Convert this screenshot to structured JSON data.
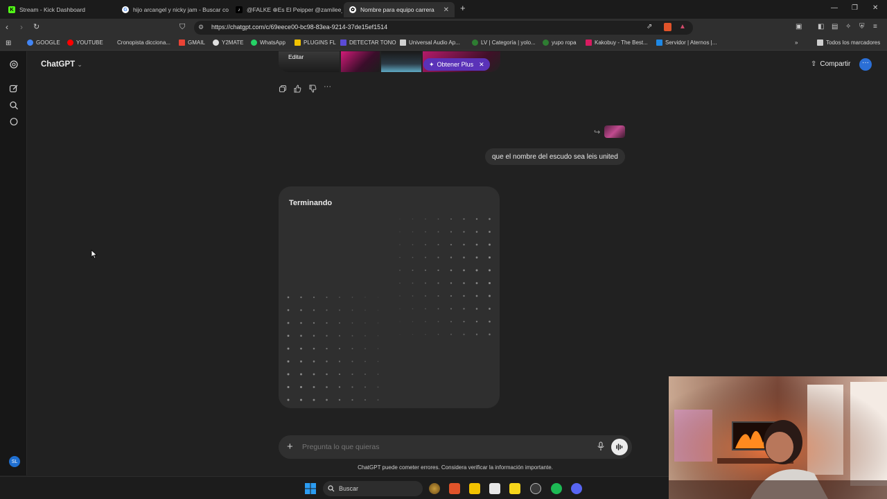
{
  "browser": {
    "tabs": [
      {
        "title": "Stream - Kick Dashboard",
        "icon": "kick-icon",
        "active": false
      },
      {
        "title": "hijo arcangel y nicky jam - Buscar co",
        "icon": "google-icon",
        "active": false
      },
      {
        "title": "@FALKE ⊕Es El Peipper @zamilee_",
        "icon": "tiktok-icon",
        "active": false
      },
      {
        "title": "Nombre para equipo carrera",
        "icon": "chatgpt-icon",
        "active": true
      }
    ],
    "url": "https://chatgpt.com/c/69eece00-bc98-83ea-9214-37de15ef1514",
    "bookmarks": [
      {
        "label": "GOOGLE",
        "color": "#4285f4"
      },
      {
        "label": "YOUTUBE",
        "color": "#ff0000"
      },
      {
        "label": "Cronopista dicciona...",
        "color": ""
      },
      {
        "label": "GMAIL",
        "color": "#ea4335"
      },
      {
        "label": "Y2MATE",
        "color": "#e0e0e0"
      },
      {
        "label": "WhatsApp",
        "color": "#25d366"
      },
      {
        "label": "PLUGINS FL",
        "color": "#f2c200"
      },
      {
        "label": "DETECTAR TONO",
        "color": "#5b4bd6"
      },
      {
        "label": "Universal Audio Ap...",
        "color": "#d0d0d0"
      },
      {
        "label": "LV | Categoría | yolo...",
        "color": "#2e7d32"
      },
      {
        "label": "yupo ropa",
        "color": "#2e7d32"
      },
      {
        "label": "Kakobuy - The Best...",
        "color": "#d81b60"
      },
      {
        "label": "Servidor | Aternos |...",
        "color": "#1e88e5"
      }
    ],
    "all_bookmarks": "Todos los marcadores"
  },
  "header": {
    "title": "ChatGPT",
    "share_label": "Compartir"
  },
  "image_strip": {
    "edit_label": "Editar",
    "plus_label": "Obtener Plus"
  },
  "user_message": "que el nombre del escudo sea leis united",
  "card": {
    "status": "Terminando"
  },
  "composer": {
    "placeholder": "Pregunta lo que quieras"
  },
  "disclaimer": "ChatGPT puede cometer errores. Considera verificar la información importante.",
  "sidebar": {
    "avatar_initials": "SL"
  },
  "taskbar": {
    "search_label": "Buscar"
  }
}
